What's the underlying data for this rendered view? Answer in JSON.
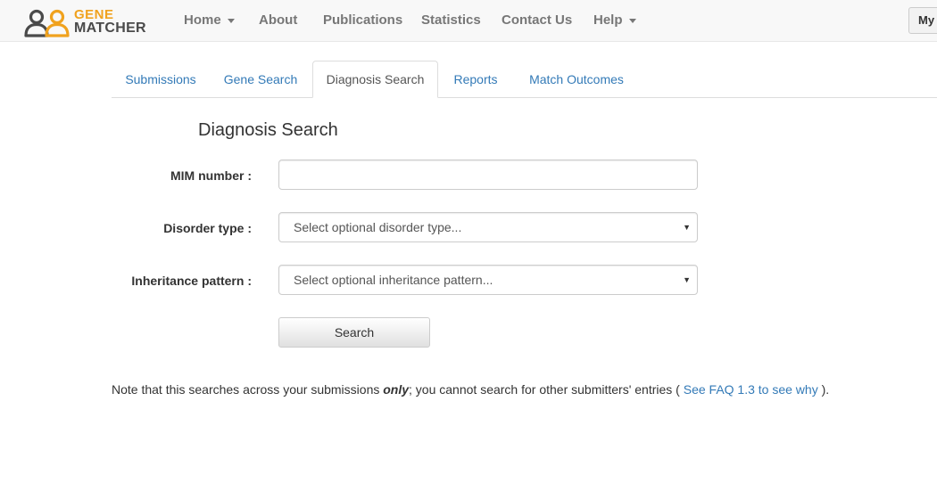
{
  "navbar": {
    "logo": {
      "line1": "GENE",
      "line2": "MATCHER"
    },
    "items": [
      {
        "label": "Home",
        "dropdown": true
      },
      {
        "label": "About"
      },
      {
        "label": "Publications"
      },
      {
        "label": "Statistics"
      },
      {
        "label": "Contact Us"
      },
      {
        "label": "Help",
        "dropdown": true
      }
    ],
    "right_button": "My"
  },
  "tabs": [
    {
      "label": "Submissions"
    },
    {
      "label": "Gene Search"
    },
    {
      "label": "Diagnosis Search",
      "active": true
    },
    {
      "label": "Reports"
    },
    {
      "label": "Match Outcomes"
    }
  ],
  "form": {
    "title": "Diagnosis Search",
    "mim_label": "MIM number :",
    "mim_value": "",
    "disorder_label": "Disorder type :",
    "disorder_placeholder": "Select optional disorder type...",
    "inheritance_label": "Inheritance pattern :",
    "inheritance_placeholder": "Select optional inheritance pattern...",
    "search_button": "Search"
  },
  "note": {
    "before": "Note that this searches across your submissions ",
    "emphasis": "only",
    "middle": "; you cannot search for other submitters' entries ( ",
    "link": "See FAQ 1.3 to see why",
    "after": " )."
  },
  "colors": {
    "brand_orange": "#f0a21e",
    "brand_gray": "#4a4a4a",
    "link_blue": "#337ab7"
  }
}
